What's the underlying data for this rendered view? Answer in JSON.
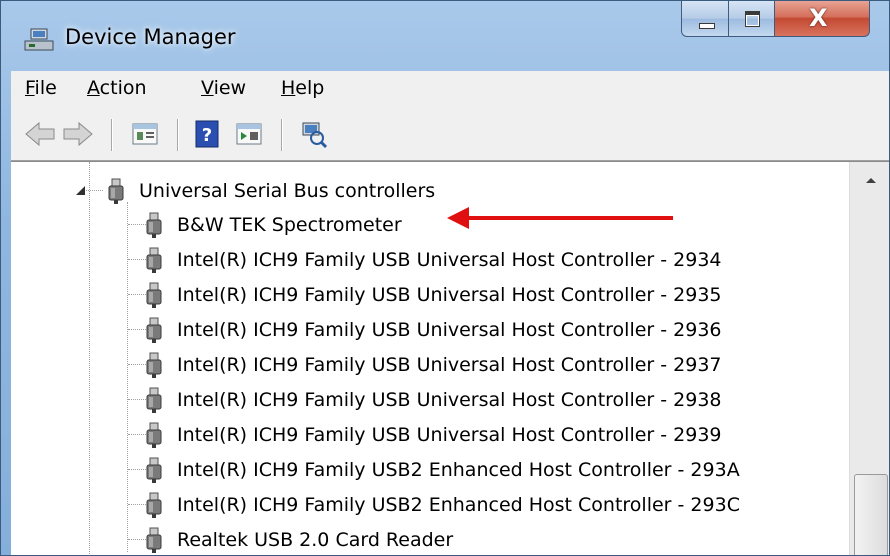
{
  "window": {
    "title": "Device Manager",
    "icon": "device-manager-icon",
    "controls": {
      "minimize": "minimize-icon",
      "maximize": "maximize-icon",
      "close": "X"
    }
  },
  "menu": {
    "items": [
      {
        "label": "File",
        "accel": "F",
        "rest": "ile"
      },
      {
        "label": "Action",
        "accel": "A",
        "rest": "ction"
      },
      {
        "label": "View",
        "accel": "V",
        "rest": "iew"
      },
      {
        "label": "Help",
        "accel": "H",
        "rest": "elp"
      }
    ]
  },
  "toolbar": {
    "buttons": [
      "back-icon",
      "forward-icon",
      "properties-icon",
      "help-icon",
      "update-driver-icon",
      "scan-hardware-icon"
    ]
  },
  "tree": {
    "category": {
      "label": "Universal Serial Bus controllers",
      "expanded": true,
      "icon": "usb-icon"
    },
    "devices": [
      "B&W TEK Spectrometer",
      "Intel(R) ICH9 Family USB Universal Host Controller - 2934",
      "Intel(R) ICH9 Family USB Universal Host Controller - 2935",
      "Intel(R) ICH9 Family USB Universal Host Controller - 2936",
      "Intel(R) ICH9 Family USB Universal Host Controller - 2937",
      "Intel(R) ICH9 Family USB Universal Host Controller - 2938",
      "Intel(R) ICH9 Family USB Universal Host Controller - 2939",
      "Intel(R) ICH9 Family USB2 Enhanced Host Controller - 293A",
      "Intel(R) ICH9 Family USB2 Enhanced Host Controller - 293C",
      "Realtek USB 2.0 Card Reader"
    ]
  },
  "colors": {
    "annotation_arrow": "#e01010",
    "title_gradient": "#8fb6df"
  }
}
